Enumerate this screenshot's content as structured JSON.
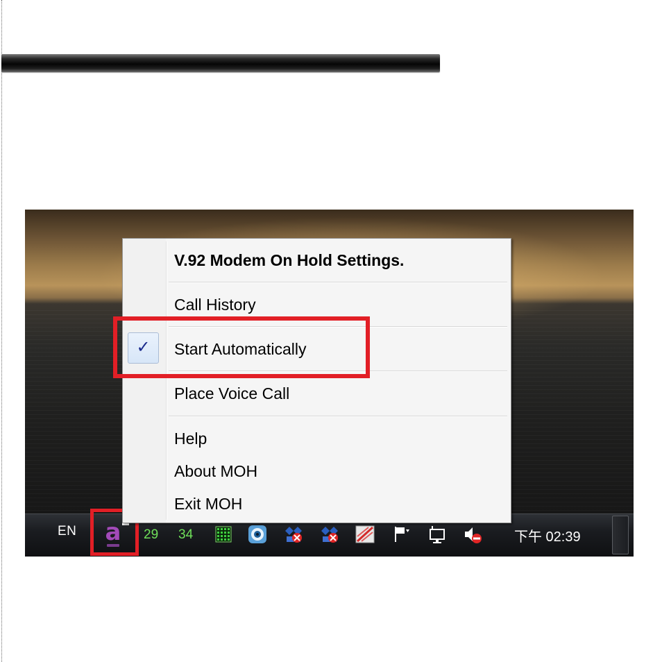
{
  "menu": {
    "title": "V.92 Modem On Hold Settings.",
    "items": [
      {
        "label": "Call History",
        "checked": false
      },
      {
        "label": "Start Automatically",
        "checked": true
      },
      {
        "label": "Place Voice Call",
        "checked": false
      },
      {
        "label": "Help",
        "checked": false
      },
      {
        "label": "About MOH",
        "checked": false
      },
      {
        "label": "Exit MOH",
        "checked": false
      }
    ],
    "check_glyph": "✓"
  },
  "taskbar": {
    "language": "EN",
    "tray_numbers": [
      "29",
      "34"
    ],
    "clock": "下午 02:39",
    "tray_icons": [
      "moh-app-icon",
      "cpu-meter-icon",
      "media-player-icon",
      "network-disconnected-icon",
      "network-disconnected-icon",
      "modem-icon",
      "action-center-flag-icon",
      "network-monitor-icon",
      "speaker-muted-icon"
    ]
  },
  "annotations": {
    "highlight_color": "#e21f26"
  }
}
